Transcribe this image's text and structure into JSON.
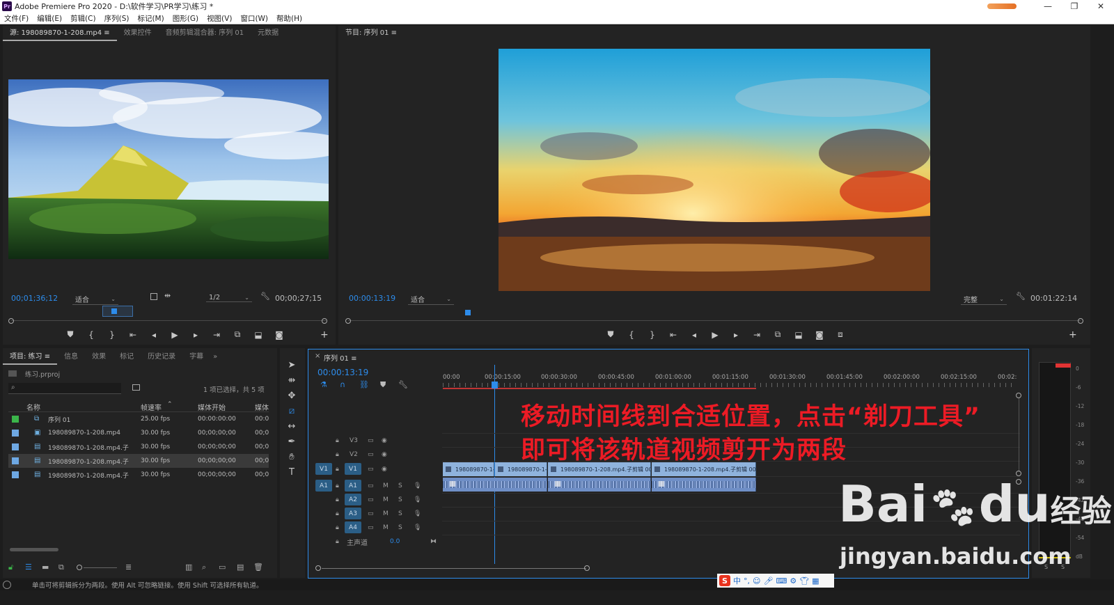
{
  "window": {
    "title": "Adobe Premiere Pro 2020 - D:\\软件学习\\PR学习\\练习 *",
    "logo": "Pr",
    "controls": [
      "—",
      "❐",
      "✕"
    ]
  },
  "menu": [
    "文件(F)",
    "编辑(E)",
    "剪辑(C)",
    "序列(S)",
    "标记(M)",
    "图形(G)",
    "视图(V)",
    "窗口(W)",
    "帮助(H)"
  ],
  "source_monitor": {
    "tabs": [
      "源: 198089870-1-208.mp4 ≡",
      "效果控件",
      "音频剪辑混合器: 序列 01",
      "元数据"
    ],
    "timecode": "00;01;36;12",
    "fit": "适合",
    "resolution": "1/2",
    "duration": "00;00;27;15"
  },
  "program_monitor": {
    "title": "节目: 序列 01 ≡",
    "timecode": "00:00:13:19",
    "fit": "适合",
    "quality": "完整",
    "duration": "00:01:22:14"
  },
  "project": {
    "tabs": [
      "项目: 练习 ≡",
      "信息",
      "效果",
      "标记",
      "历史记录",
      "字幕",
      "»"
    ],
    "file": "练习.prproj",
    "selection": "1 项已选择，共 5 项",
    "columns": [
      "名称",
      "帧速率",
      "媒体开始",
      "媒体"
    ],
    "rows": [
      {
        "name": "序列 01",
        "fps": "25.00 fps",
        "start": "00:00:00:00",
        "x": "00:0",
        "color": "#3bb54a",
        "icon": "sequence-icon"
      },
      {
        "name": "198089870-1-208.mp4",
        "fps": "30.00 fps",
        "start": "00;00;00;00",
        "x": "00;0",
        "color": "#6ea8e3",
        "icon": "video-clip-icon"
      },
      {
        "name": "198089870-1-208.mp4.子",
        "fps": "30.00 fps",
        "start": "00;00;00;00",
        "x": "00;0",
        "color": "#6ea8e3",
        "icon": "subclip-icon"
      },
      {
        "name": "198089870-1-208.mp4.子",
        "fps": "30.00 fps",
        "start": "00;00;00;00",
        "x": "00;0",
        "color": "#6ea8e3",
        "icon": "subclip-icon"
      },
      {
        "name": "198089870-1-208.mp4.子",
        "fps": "30.00 fps",
        "start": "00;00;00;00",
        "x": "00;0",
        "color": "#6ea8e3",
        "icon": "subclip-icon"
      }
    ]
  },
  "timeline": {
    "tab": "序列 01 ≡",
    "close": "×",
    "timecode": "00:00:13:19",
    "ruler": [
      "00:00",
      "00:00:15:00",
      "00:00:30:00",
      "00:00:45:00",
      "00:01:00:00",
      "00:01:15:00",
      "00:01:30:00",
      "00:01:45:00",
      "00:02:00:00",
      "00:02:15:00",
      "00:02:"
    ],
    "tracks_video": [
      "V3",
      "V2",
      "V1"
    ],
    "tracks_audio": [
      "A1",
      "A2",
      "A3",
      "A4"
    ],
    "master": "主声道",
    "master_value": "0.0",
    "src_v": "V1",
    "src_a": "A1",
    "mute": "M",
    "solo": "S",
    "clips": [
      "198089870-1-",
      "198089870-1-",
      "198089870-1-208.mp4.子剪辑 001",
      "198089870-1-208.mp4.子剪辑 002"
    ]
  },
  "annotation": {
    "line1": "移动时间线到合适位置，点击“剃刀工具”",
    "line2": "即可将该轨道视频剪开为两段"
  },
  "meter": {
    "ticks": [
      "0",
      "-6",
      "-12",
      "-18",
      "-24",
      "-30",
      "-36",
      "-42",
      "-48",
      "-54",
      "dB"
    ],
    "solo": [
      "S",
      "S"
    ]
  },
  "status": "单击可将剪辑拆分为两段。使用 Alt 可忽略链接。使用 Shift 可选择所有轨道。",
  "ime": {
    "logo": "S",
    "lang": "中"
  },
  "watermark": {
    "brand": "Bai",
    "brand2": "du",
    "suffix": "经验",
    "url": "jingyan.baidu.com"
  }
}
